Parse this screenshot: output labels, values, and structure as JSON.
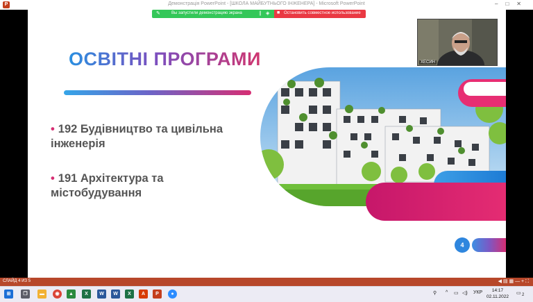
{
  "window": {
    "title": "Демонстрація PowerPoint - [ШКОЛА МАЙБУТНЬОГО ІНЖЕНЕРА] - Microsoft PowerPoint",
    "app_icon": "P"
  },
  "share_banner": {
    "sharing_text": "Вы запустили демонстрацию экрана",
    "stop_text": "Остановить совместное использование",
    "green_color": "#34c759",
    "red_color": "#ea3943"
  },
  "video": {
    "participant_name": "ХЕСИН"
  },
  "slide": {
    "heading": "ОСВІТНІ ПРОГРАМИ",
    "bullets": [
      "192 Будівництво та цивільна інженерія",
      "191 Архітектура та містобудування"
    ],
    "page_number": "4",
    "bullet_color": "#d62e73",
    "accent_blue": "#2a8fe0",
    "accent_pink": "#d62e73"
  },
  "statusbar": {
    "slide_info": "СЛАЙД 4 ИЗ 5"
  },
  "taskbar": {
    "language": "УКР",
    "time": "14:17",
    "date": "02.11.2022",
    "notification_count": "2"
  }
}
